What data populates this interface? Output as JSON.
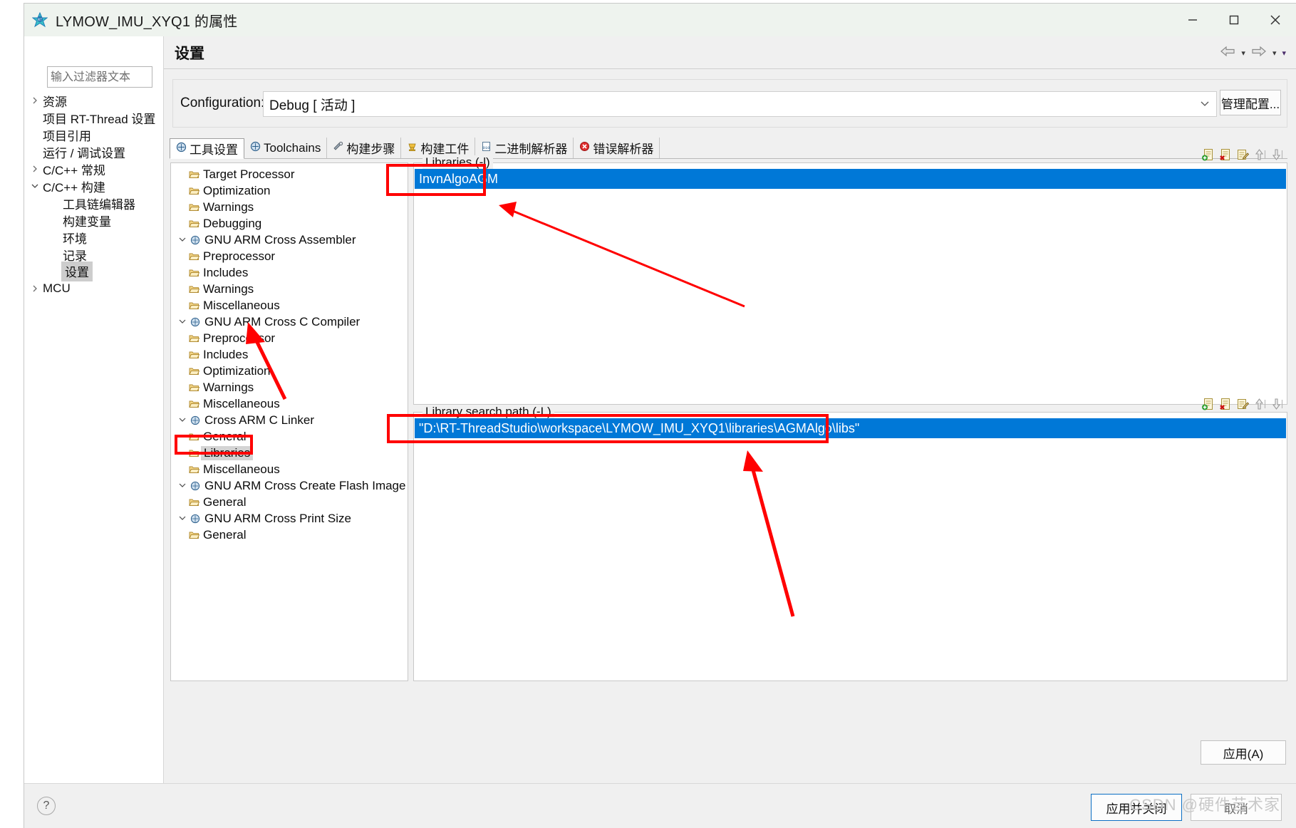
{
  "window": {
    "title": "LYMOW_IMU_XYQ1 的属性",
    "icon": "rt-thread-logo-icon",
    "buttons": {
      "minimize": "minimize-icon",
      "maximize": "maximize-icon",
      "close": "close-icon"
    }
  },
  "sidebar": {
    "filter_placeholder": "输入过滤器文本",
    "filter_value": "",
    "items": [
      {
        "label": "资源",
        "indent": 0,
        "twisty": "collapsed",
        "selected": false
      },
      {
        "label": "项目 RT-Thread 设置",
        "indent": 1,
        "twisty": "none",
        "selected": false
      },
      {
        "label": "项目引用",
        "indent": 1,
        "twisty": "none",
        "selected": false
      },
      {
        "label": "运行 / 调试设置",
        "indent": 1,
        "twisty": "none",
        "selected": false
      },
      {
        "label": "C/C++ 常规",
        "indent": 0,
        "twisty": "collapsed",
        "selected": false
      },
      {
        "label": "C/C++ 构建",
        "indent": 0,
        "twisty": "expanded",
        "selected": false
      },
      {
        "label": "工具链编辑器",
        "indent": 2,
        "twisty": "none",
        "selected": false
      },
      {
        "label": "构建变量",
        "indent": 2,
        "twisty": "none",
        "selected": false
      },
      {
        "label": "环境",
        "indent": 2,
        "twisty": "none",
        "selected": false
      },
      {
        "label": "记录",
        "indent": 2,
        "twisty": "none",
        "selected": false
      },
      {
        "label": "设置",
        "indent": 2,
        "twisty": "none",
        "selected": true
      },
      {
        "label": "MCU",
        "indent": 0,
        "twisty": "collapsed",
        "selected": false
      }
    ]
  },
  "page": {
    "title": "设置",
    "nav": {
      "back": "back-arrow-icon",
      "back_menu": "chevron-down-icon",
      "forward": "forward-arrow-icon",
      "forward_menu": "chevron-down-icon",
      "more": "chevron-down-icon"
    }
  },
  "configuration": {
    "label": "Configuration:",
    "value": "Debug  [ 活动 ]",
    "dropdown_icon": "chevron-down-icon",
    "manage_button": "管理配置..."
  },
  "tabs": [
    {
      "label": "工具设置",
      "icon": "tool-settings-icon",
      "active": true
    },
    {
      "label": "Toolchains",
      "icon": "toolchains-icon",
      "active": false
    },
    {
      "label": "构建步骤",
      "icon": "build-steps-icon",
      "active": false
    },
    {
      "label": "构建工件",
      "icon": "build-artifact-icon",
      "active": false
    },
    {
      "label": "二进制解析器",
      "icon": "binary-parser-icon",
      "active": false
    },
    {
      "label": "错误解析器",
      "icon": "error-parser-icon",
      "active": false
    }
  ],
  "settings_tree": [
    {
      "label": "Target Processor",
      "level": 1,
      "twisty": "none",
      "icon": "folder-icon",
      "highlight": false
    },
    {
      "label": "Optimization",
      "level": 1,
      "twisty": "none",
      "icon": "folder-icon",
      "highlight": false
    },
    {
      "label": "Warnings",
      "level": 1,
      "twisty": "none",
      "icon": "folder-icon",
      "highlight": false
    },
    {
      "label": "Debugging",
      "level": 1,
      "twisty": "none",
      "icon": "folder-icon",
      "highlight": false
    },
    {
      "label": "GNU ARM Cross Assembler",
      "level": 0,
      "twisty": "expanded",
      "icon": "tool-icon",
      "highlight": false
    },
    {
      "label": "Preprocessor",
      "level": 1,
      "twisty": "none",
      "icon": "folder-icon",
      "highlight": false
    },
    {
      "label": "Includes",
      "level": 1,
      "twisty": "none",
      "icon": "folder-icon",
      "highlight": false
    },
    {
      "label": "Warnings",
      "level": 1,
      "twisty": "none",
      "icon": "folder-icon",
      "highlight": false
    },
    {
      "label": "Miscellaneous",
      "level": 1,
      "twisty": "none",
      "icon": "folder-icon",
      "highlight": false
    },
    {
      "label": "GNU ARM Cross C Compiler",
      "level": 0,
      "twisty": "expanded",
      "icon": "tool-icon",
      "highlight": false
    },
    {
      "label": "Preprocessor",
      "level": 1,
      "twisty": "none",
      "icon": "folder-icon",
      "highlight": false
    },
    {
      "label": "Includes",
      "level": 1,
      "twisty": "none",
      "icon": "folder-icon",
      "highlight": false
    },
    {
      "label": "Optimization",
      "level": 1,
      "twisty": "none",
      "icon": "folder-icon",
      "highlight": false
    },
    {
      "label": "Warnings",
      "level": 1,
      "twisty": "none",
      "icon": "folder-icon",
      "highlight": false
    },
    {
      "label": "Miscellaneous",
      "level": 1,
      "twisty": "none",
      "icon": "folder-icon",
      "highlight": false
    },
    {
      "label": "Cross ARM C Linker",
      "level": 0,
      "twisty": "expanded",
      "icon": "tool-icon",
      "highlight": false
    },
    {
      "label": "General",
      "level": 1,
      "twisty": "none",
      "icon": "folder-icon",
      "highlight": false
    },
    {
      "label": "Libraries",
      "level": 1,
      "twisty": "none",
      "icon": "folder-icon",
      "highlight": true
    },
    {
      "label": "Miscellaneous",
      "level": 1,
      "twisty": "none",
      "icon": "folder-icon",
      "highlight": false
    },
    {
      "label": "GNU ARM Cross Create Flash Image",
      "level": 0,
      "twisty": "expanded",
      "icon": "tool-icon",
      "highlight": false
    },
    {
      "label": "General",
      "level": 1,
      "twisty": "none",
      "icon": "folder-icon",
      "highlight": false
    },
    {
      "label": "GNU ARM Cross Print Size",
      "level": 0,
      "twisty": "expanded",
      "icon": "tool-icon",
      "highlight": false
    },
    {
      "label": "General",
      "level": 1,
      "twisty": "none",
      "icon": "folder-icon",
      "highlight": false
    }
  ],
  "libraries_panel": {
    "caption": "Libraries (-l)",
    "toolbar": [
      "add-icon",
      "delete-icon",
      "edit-icon",
      "move-up-icon",
      "move-down-icon"
    ],
    "rows": [
      "InvnAlgoAGM"
    ],
    "selected_color": "#0078d7"
  },
  "library_paths_panel": {
    "caption": "Library search path (-L)",
    "toolbar": [
      "add-icon",
      "delete-icon",
      "edit-icon",
      "move-up-icon",
      "move-down-icon"
    ],
    "rows": [
      "\"D:\\RT-ThreadStudio\\workspace\\LYMOW_IMU_XYQ1\\libraries\\AGMAlgo\\libs\""
    ],
    "selected_color": "#0078d7"
  },
  "buttons": {
    "apply": "应用(A)",
    "apply_and_close": "应用并关闭",
    "cancel": "取消",
    "help": "?"
  },
  "annotations": {
    "highlight_color": "#ff0000",
    "arrow_count": 3
  },
  "watermark": "CSDN @硬件艺术家"
}
